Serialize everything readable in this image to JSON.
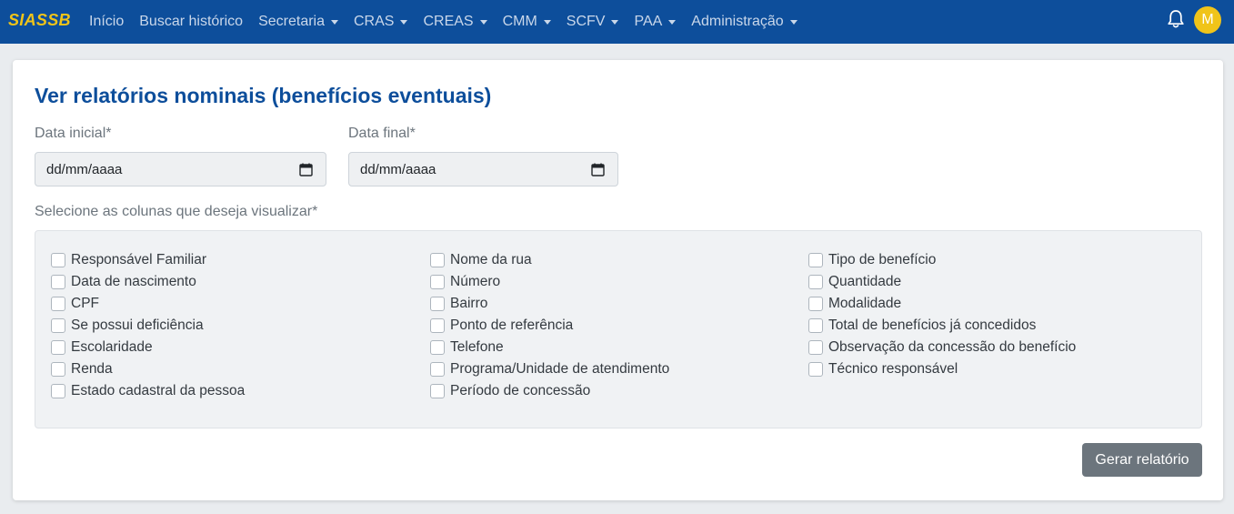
{
  "navbar": {
    "brand": "SIASSB",
    "items": [
      {
        "label": "Início",
        "dropdown": false
      },
      {
        "label": "Buscar histórico",
        "dropdown": false
      },
      {
        "label": "Secretaria",
        "dropdown": true
      },
      {
        "label": "CRAS",
        "dropdown": true
      },
      {
        "label": "CREAS",
        "dropdown": true
      },
      {
        "label": "CMM",
        "dropdown": true
      },
      {
        "label": "SCFV",
        "dropdown": true
      },
      {
        "label": "PAA",
        "dropdown": true
      },
      {
        "label": "Administração",
        "dropdown": true
      }
    ],
    "notification_icon": "bell-icon",
    "avatar_initial": "M"
  },
  "page": {
    "title": "Ver relatórios nominais (benefícios eventuais)",
    "date_start": {
      "label": "Data inicial*",
      "placeholder": "dd/mm/aaaa"
    },
    "date_end": {
      "label": "Data final*",
      "placeholder": "dd/mm/aaaa"
    },
    "columns_label": "Selecione as colunas que deseja visualizar*",
    "columns": [
      [
        "Responsável Familiar",
        "Data de nascimento",
        "CPF",
        "Se possui deficiência",
        "Escolaridade",
        "Renda",
        "Estado cadastral da pessoa"
      ],
      [
        "Nome da rua",
        "Número",
        "Bairro",
        "Ponto de referência",
        "Telefone",
        "Programa/Unidade de atendimento",
        "Período de concessão"
      ],
      [
        "Tipo de benefício",
        "Quantidade",
        "Modalidade",
        "Total de benefícios já concedidos",
        "Observação da concessão do benefício",
        "Técnico responsável"
      ]
    ],
    "generate_button": "Gerar relatório"
  },
  "colors": {
    "navbar": "#0d4e9b",
    "brand": "#f0c419",
    "title": "#0d4e9b",
    "button": "#6c757d"
  }
}
